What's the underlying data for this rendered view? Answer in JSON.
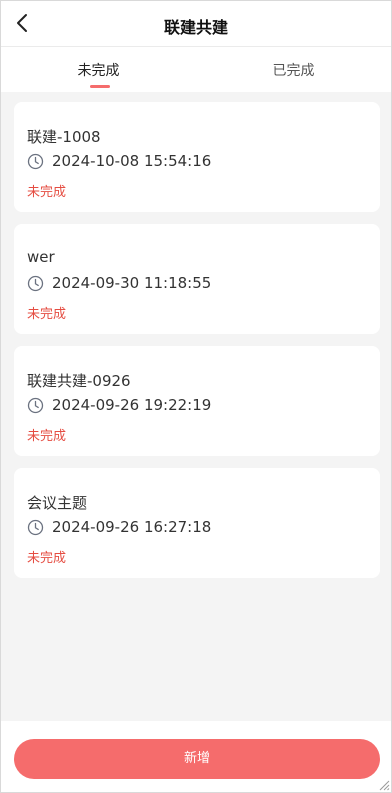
{
  "header": {
    "title": "联建共建",
    "back_icon": "back-chevron-icon"
  },
  "tabs": [
    {
      "label": "未完成",
      "active": true
    },
    {
      "label": "已完成",
      "active": false
    }
  ],
  "items": [
    {
      "name": "联建-1008",
      "time": "2024-10-08 15:54:16",
      "status": "未完成"
    },
    {
      "name": "wer",
      "time": "2024-09-30 11:18:55",
      "status": "未完成"
    },
    {
      "name": "联建共建-0926",
      "time": "2024-09-26 19:22:19",
      "status": "未完成"
    },
    {
      "name": "会议主题",
      "time": "2024-09-26 16:27:18",
      "status": "未完成"
    }
  ],
  "footer": {
    "add_label": "新增"
  },
  "colors": {
    "accent": "#f56c6c",
    "status": "#e54d42",
    "background": "#f4f4f4"
  }
}
